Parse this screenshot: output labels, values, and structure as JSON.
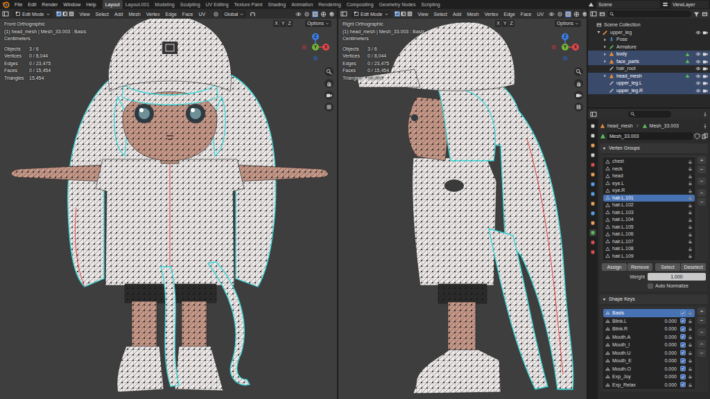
{
  "topbar": {
    "menus": [
      "File",
      "Edit",
      "Render",
      "Window",
      "Help"
    ],
    "workspaces": [
      {
        "label": "Layout",
        "selected": true
      },
      {
        "label": "Layout.001",
        "selected": false
      },
      {
        "label": "Modeling",
        "selected": false
      },
      {
        "label": "Sculpting",
        "selected": false
      },
      {
        "label": "UV Editing",
        "selected": false
      },
      {
        "label": "Texture Paint",
        "selected": false
      },
      {
        "label": "Shading",
        "selected": false
      },
      {
        "label": "Animation",
        "selected": false
      },
      {
        "label": "Rendering",
        "selected": false
      },
      {
        "label": "Compositing",
        "selected": false
      },
      {
        "label": "Geometry Nodes",
        "selected": false
      },
      {
        "label": "Scripting",
        "selected": false
      }
    ],
    "scene": "Scene",
    "view_layer": "ViewLayer"
  },
  "viewports": [
    {
      "header": {
        "mode": "Edit Mode",
        "menus": [
          "View",
          "Select",
          "Add",
          "Mesh",
          "Vertex",
          "Edge",
          "Face",
          "UV"
        ],
        "orientation": "Global",
        "axes": [
          "X",
          "Y",
          "Z"
        ],
        "options": "Options"
      },
      "overlay": {
        "view": "Front Orthographic",
        "object": "(1) head_mesh | Mesh_33.003 : Basis",
        "units": "Centimeters",
        "stats": [
          {
            "label": "Objects",
            "value": "3 / 6"
          },
          {
            "label": "Vertices",
            "value": "0 / 8,044"
          },
          {
            "label": "Edges",
            "value": "0 / 23,475"
          },
          {
            "label": "Faces",
            "value": "0 / 15,454"
          },
          {
            "label": "Triangles",
            "value": "15,454"
          }
        ]
      },
      "gizmo": [
        {
          "label": "Z",
          "color": "#3d7ee8"
        },
        {
          "label": "Y",
          "color": "#74b53a"
        },
        {
          "label": "X",
          "color": "#e5474b"
        }
      ]
    },
    {
      "header": {
        "mode": "Edit Mode",
        "menus": [
          "View",
          "Select",
          "Add",
          "Mesh",
          "Vertex",
          "Edge",
          "Face",
          "UV"
        ],
        "axes": [
          "X",
          "Y",
          "Z"
        ],
        "options": "Options"
      },
      "overlay": {
        "view": "Right Orthographic",
        "object": "(1) head_mesh | Mesh_33.003 : Basis",
        "units": "Centimeters",
        "stats": [
          {
            "label": "Objects",
            "value": "3 / 6"
          },
          {
            "label": "Vertices",
            "value": "0 / 8,044"
          },
          {
            "label": "Edges",
            "value": "0 / 23,475"
          },
          {
            "label": "Faces",
            "value": "0 / 15,454"
          },
          {
            "label": "Triangles",
            "value": "15,454"
          }
        ]
      },
      "gizmo": [
        {
          "label": "Z",
          "color": "#3d7ee8"
        },
        {
          "label": "Y",
          "color": "#74b53a"
        },
        {
          "label": "X",
          "color": "#e5474b"
        }
      ]
    }
  ],
  "outliner": {
    "items": [
      {
        "label": "Scene Collection",
        "kind": "collection",
        "selected": false,
        "children": [
          {
            "label": "upper_leg",
            "kind": "armature_object",
            "expanded": true,
            "selected": false,
            "children": [
              {
                "label": "Pose",
                "kind": "pose",
                "expanded": false,
                "selected": false,
                "children": []
              },
              {
                "label": "Armature",
                "kind": "armature_data",
                "expanded": false,
                "selected": false,
                "children": []
              },
              {
                "label": "body",
                "kind": "mesh_object",
                "expanded": false,
                "selected": true,
                "children": []
              },
              {
                "label": "face_parts",
                "kind": "mesh_object",
                "expanded": false,
                "selected": true,
                "children": []
              },
              {
                "label": "hair_root",
                "kind": "bone_object",
                "selected": false,
                "children": []
              },
              {
                "label": "head_mesh",
                "kind": "mesh_object",
                "expanded": false,
                "selected": true,
                "children": []
              },
              {
                "label": "upper_leg.L",
                "kind": "bone_object",
                "selected": true,
                "children": []
              },
              {
                "label": "upper_leg.R",
                "kind": "bone_object",
                "selected": true,
                "children": []
              }
            ]
          }
        ]
      }
    ]
  },
  "properties": {
    "breadcrumb": [
      "head_mesh",
      "Mesh_33.003"
    ],
    "data_name": "Mesh_33.003",
    "vertex_groups": {
      "title": "Vertex Groups",
      "expanded": true,
      "items": [
        {
          "name": "chest",
          "selected": false
        },
        {
          "name": "neck",
          "selected": false
        },
        {
          "name": "head",
          "selected": false
        },
        {
          "name": "eye.L",
          "selected": false
        },
        {
          "name": "eye.R",
          "selected": false
        },
        {
          "name": "hair.L.101",
          "selected": true
        },
        {
          "name": "hair.L.102",
          "selected": false
        },
        {
          "name": "hair.L.103",
          "selected": false
        },
        {
          "name": "hair.L.104",
          "selected": false
        },
        {
          "name": "hair.L.105",
          "selected": false
        },
        {
          "name": "hair.L.106",
          "selected": false
        },
        {
          "name": "hair.L.107",
          "selected": false
        },
        {
          "name": "hair.L.108",
          "selected": false
        },
        {
          "name": "hair.L.109",
          "selected": false
        }
      ],
      "list_buttons": [
        "+",
        "−"
      ],
      "actions": [
        "Assign",
        "Remove",
        "Select",
        "Deselect"
      ],
      "weight": {
        "label": "Weight",
        "value": "1.000"
      },
      "auto_normalize": {
        "label": "Auto Normalize",
        "checked": false
      }
    },
    "shape_keys": {
      "title": "Shape Keys",
      "expanded": true,
      "items": [
        {
          "name": "Basis",
          "selected": true,
          "enabled": true
        },
        {
          "name": "Blink.L",
          "value": "0.000",
          "selected": false,
          "enabled": true
        },
        {
          "name": "Blink.R",
          "value": "0.000",
          "selected": false,
          "enabled": true
        },
        {
          "name": "Mouth.A",
          "value": "0.000",
          "selected": false,
          "enabled": true
        },
        {
          "name": "Mouth_I",
          "value": "0.000",
          "selected": false,
          "enabled": true
        },
        {
          "name": "Mouth.U",
          "value": "0.000",
          "selected": false,
          "enabled": true
        },
        {
          "name": "Mouth_E",
          "value": "0.000",
          "selected": false,
          "enabled": true
        },
        {
          "name": "Mouth.O",
          "value": "0.000",
          "selected": false,
          "enabled": true
        },
        {
          "name": "Exp_Joy",
          "value": "0.000",
          "selected": false,
          "enabled": true
        },
        {
          "name": "Exp_Relax",
          "value": "0.000",
          "selected": false,
          "enabled": true
        }
      ],
      "list_buttons": [
        "+",
        "−"
      ]
    }
  }
}
